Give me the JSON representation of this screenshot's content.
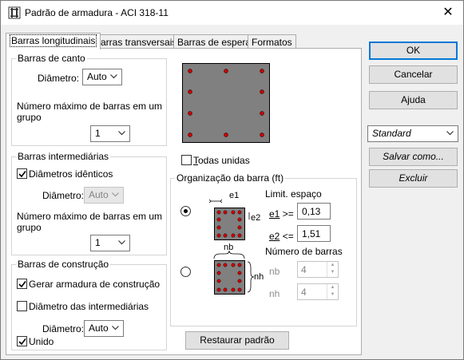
{
  "window": {
    "title": "Padrão de armadura - ACI 318-11",
    "icon": "rebar-pattern-icon",
    "close": "✕"
  },
  "tabs": [
    {
      "label": "Barras longitudinais",
      "active": true
    },
    {
      "label": "Barras transversais",
      "active": false
    },
    {
      "label": "Barras de espera",
      "active": false
    },
    {
      "label": "Formatos",
      "active": false
    }
  ],
  "corner_bars": {
    "title": "Barras de canto",
    "diameter_label": "Diâmetro:",
    "diameter_value": "Auto",
    "max_bars_label_1": "Número máximo de barras em um",
    "max_bars_label_2": "grupo",
    "max_bars_value": "1"
  },
  "intermediate_bars": {
    "title": "Barras intermediárias",
    "identical_label": "Diâmetros idênticos",
    "identical_checked": true,
    "diameter_label": "Diâmetro:",
    "diameter_value": "Auto",
    "max_bars_label_1": "Número máximo de barras em um",
    "max_bars_label_2": "grupo",
    "max_bars_value": "1"
  },
  "construction_bars": {
    "title": "Barras de construção",
    "generate_label": "Gerar armadura de construção",
    "generate_checked": true,
    "intermediate_diam_label": "Diâmetro das intermediárias",
    "intermediate_diam_checked": false,
    "diameter_label": "Diâmetro:",
    "diameter_value": "Auto",
    "joined_label": "Unido",
    "joined_checked": true
  },
  "all_joined": {
    "label_first": "T",
    "label_rest": "odas unidas",
    "checked": false
  },
  "organization": {
    "title": "Organização da barra (ft)",
    "spacing_limit_label": "Limit. espaço",
    "e1_label": "e1",
    "e1_op": ">=",
    "e1_value": "0,13",
    "e2_label": "e2",
    "e2_op": "<=",
    "e2_value": "1,51",
    "diagram_e1": "e1",
    "diagram_e2": "e2",
    "bar_count_label": "Número de barras",
    "nb_label": "nb",
    "nb_value": "4",
    "nh_label": "nh",
    "nh_value": "4",
    "diagram_nb": "nb",
    "diagram_nh": "nh",
    "spacing_mode_selected": true,
    "count_mode_selected": false
  },
  "restore_button": "Restaurar padrão",
  "side": {
    "ok": "OK",
    "cancel": "Cancelar",
    "help": "Ajuda",
    "preset_value": "Standard",
    "save_as": "Salvar como...",
    "delete": "Excluir"
  },
  "colors": {
    "rebar": "#cc0000",
    "section_fill": "#808080",
    "accent": "#0078d7"
  }
}
